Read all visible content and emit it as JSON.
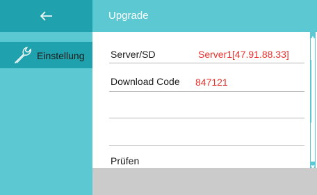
{
  "header": {
    "title": "Upgrade"
  },
  "sidebar": {
    "items": [
      {
        "label": "Einstellung",
        "icon": "wrench-icon"
      }
    ]
  },
  "form": {
    "server": {
      "label": "Server/SD",
      "value": "Server1[47.91.88.33]"
    },
    "download_code": {
      "label": "Download Code",
      "value": "847121"
    },
    "check_label": "Prüfen"
  },
  "colors": {
    "accent": "#1fa2ad",
    "accent_light": "#5cc8d2",
    "value_red": "#e8302a",
    "footer_gray": "#cbcbcb"
  }
}
